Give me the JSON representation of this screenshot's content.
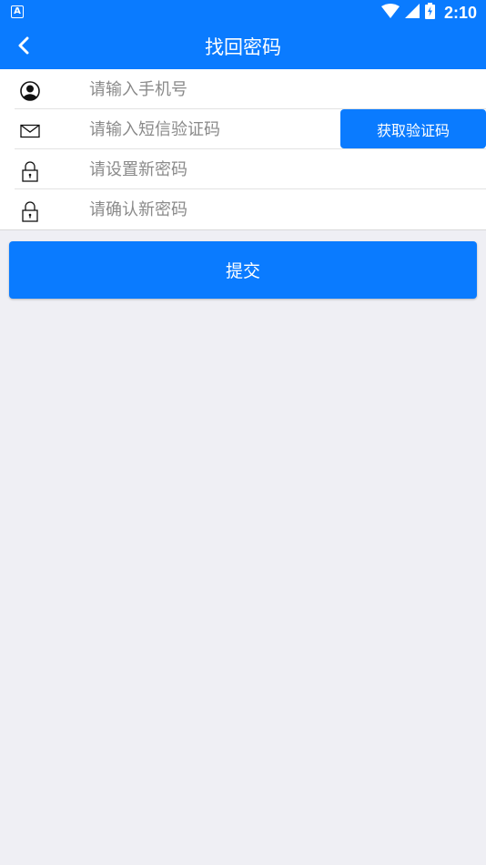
{
  "status_bar": {
    "time": "2:10",
    "notification_icon": "a-letter-icon",
    "wifi_icon": "wifi-icon",
    "signal_icon": "signal-icon",
    "battery_icon": "battery-charging-icon"
  },
  "header": {
    "title": "找回密码",
    "back_icon": "chevron-left-icon"
  },
  "form": {
    "phone": {
      "placeholder": "请输入手机号",
      "value": "",
      "icon": "person-icon"
    },
    "sms_code": {
      "placeholder": "请输入短信验证码",
      "value": "",
      "icon": "envelope-icon"
    },
    "get_code_label": "获取验证码",
    "new_password": {
      "placeholder": "请设置新密码",
      "value": "",
      "icon": "lock-icon"
    },
    "confirm_password": {
      "placeholder": "请确认新密码",
      "value": "",
      "icon": "lock-icon"
    }
  },
  "submit_label": "提交",
  "colors": {
    "primary": "#0a7bff",
    "background": "#efeff4",
    "surface": "#ffffff",
    "placeholder": "#8a8a8a"
  }
}
